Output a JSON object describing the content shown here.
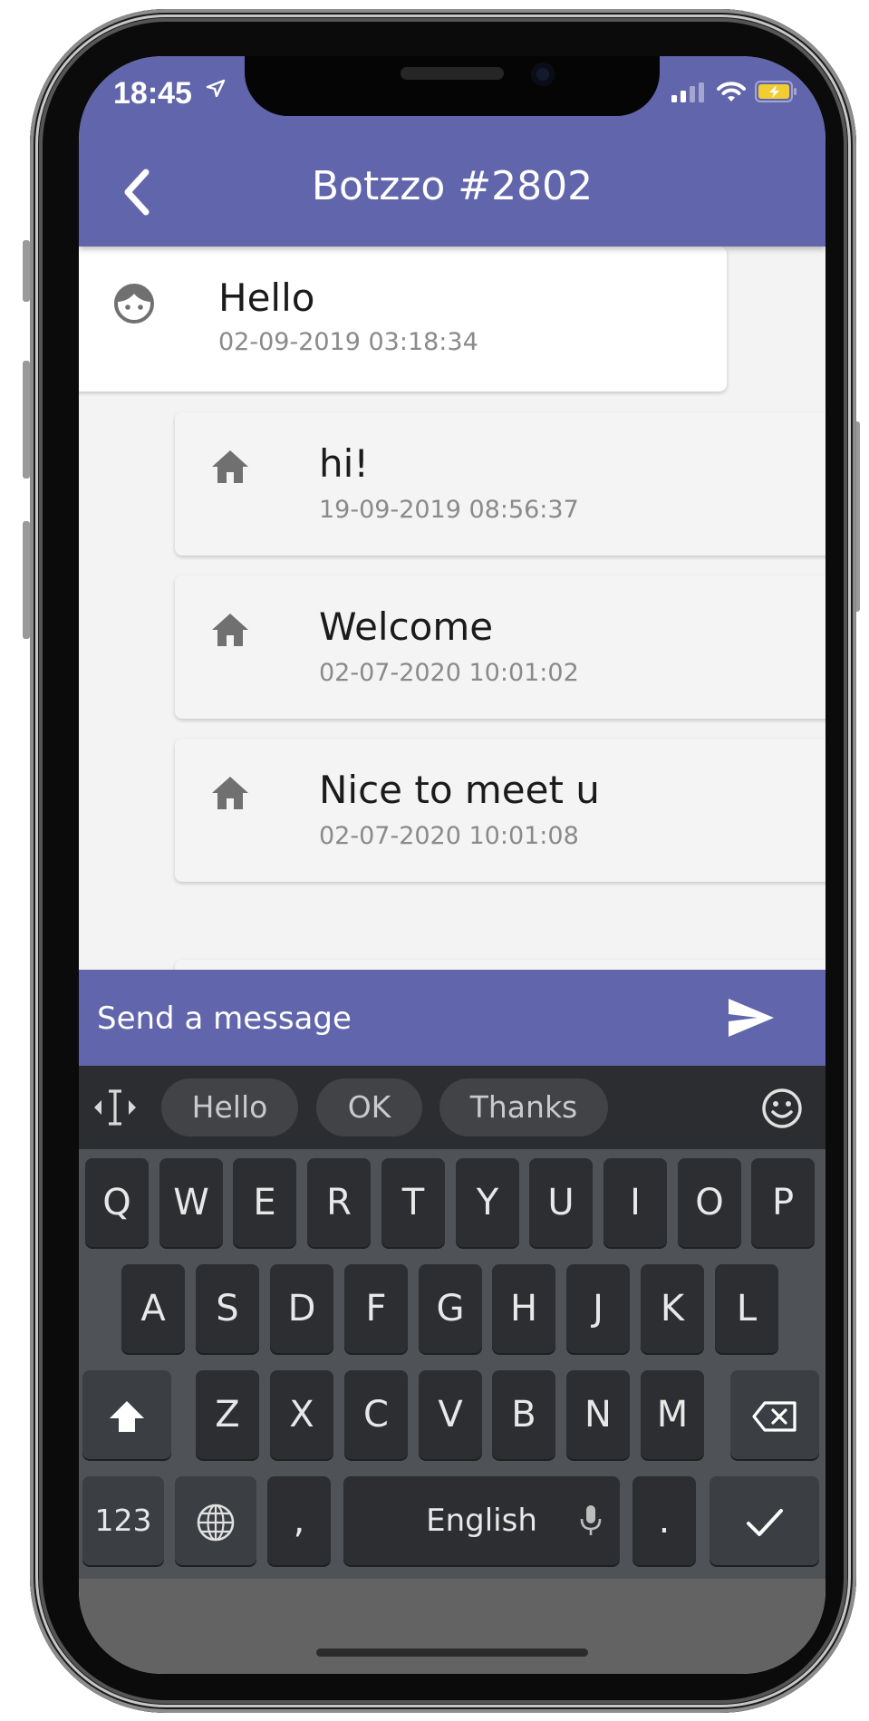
{
  "status": {
    "time": "18:45"
  },
  "header": {
    "title": "Botzzo #2802"
  },
  "icons": {
    "back": "chevron-left-icon",
    "user": "user-face-icon",
    "bot": "home-icon",
    "send": "send-icon",
    "cursor": "text-cursor-icon",
    "emoji": "smiley-icon",
    "shift": "shift-icon",
    "backspace": "backspace-icon",
    "globe": "globe-icon",
    "mic": "microphone-icon",
    "enter": "checkmark-icon"
  },
  "messages": [
    {
      "sender": "user",
      "text": "Hello",
      "time": "02-09-2019 03:18:34"
    },
    {
      "sender": "bot",
      "text": "hi!",
      "time": "19-09-2019 08:56:37"
    },
    {
      "sender": "bot",
      "text": "Welcome",
      "time": "02-07-2020 10:01:02"
    },
    {
      "sender": "bot",
      "text": "Nice to meet u",
      "time": "02-07-2020 10:01:08"
    }
  ],
  "composer": {
    "placeholder": "Send a message"
  },
  "keyboard": {
    "suggestions": [
      "Hello",
      "OK",
      "Thanks"
    ],
    "row1": [
      "Q",
      "W",
      "E",
      "R",
      "T",
      "Y",
      "U",
      "I",
      "O",
      "P"
    ],
    "row2": [
      "A",
      "S",
      "D",
      "F",
      "G",
      "H",
      "J",
      "K",
      "L"
    ],
    "row3": [
      "Z",
      "X",
      "C",
      "V",
      "B",
      "N",
      "M"
    ],
    "numbers_label": "123",
    "comma": ",",
    "space_label": "English",
    "period": "."
  },
  "colors": {
    "accent": "#6165ab",
    "keyboard_bg": "#4f5256",
    "key_bg": "#2c2e31"
  }
}
